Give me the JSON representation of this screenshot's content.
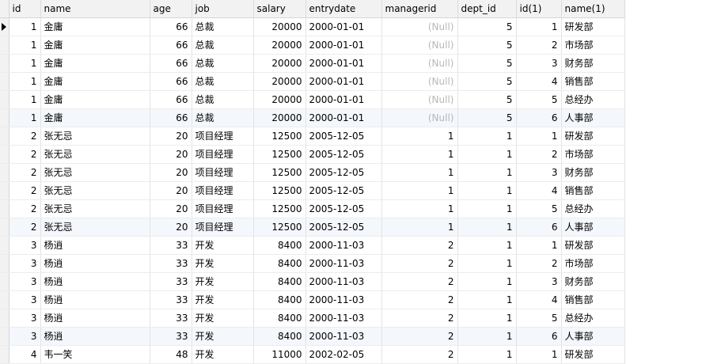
{
  "columns": [
    "id",
    "name",
    "age",
    "job",
    "salary",
    "entrydate",
    "managerid",
    "dept_id",
    "id(1)",
    "name(1)"
  ],
  "null_label": "(Null)",
  "rows": [
    {
      "id": "1",
      "name": "金庸",
      "age": "66",
      "job": "总裁",
      "salary": "20000",
      "entrydate": "2000-01-01",
      "managerid": "(Null)",
      "dept_id": "5",
      "id1": "1",
      "name1": "研发部"
    },
    {
      "id": "1",
      "name": "金庸",
      "age": "66",
      "job": "总裁",
      "salary": "20000",
      "entrydate": "2000-01-01",
      "managerid": "(Null)",
      "dept_id": "5",
      "id1": "2",
      "name1": "市场部"
    },
    {
      "id": "1",
      "name": "金庸",
      "age": "66",
      "job": "总裁",
      "salary": "20000",
      "entrydate": "2000-01-01",
      "managerid": "(Null)",
      "dept_id": "5",
      "id1": "3",
      "name1": "财务部"
    },
    {
      "id": "1",
      "name": "金庸",
      "age": "66",
      "job": "总裁",
      "salary": "20000",
      "entrydate": "2000-01-01",
      "managerid": "(Null)",
      "dept_id": "5",
      "id1": "4",
      "name1": "销售部"
    },
    {
      "id": "1",
      "name": "金庸",
      "age": "66",
      "job": "总裁",
      "salary": "20000",
      "entrydate": "2000-01-01",
      "managerid": "(Null)",
      "dept_id": "5",
      "id1": "5",
      "name1": "总经办"
    },
    {
      "id": "1",
      "name": "金庸",
      "age": "66",
      "job": "总裁",
      "salary": "20000",
      "entrydate": "2000-01-01",
      "managerid": "(Null)",
      "dept_id": "5",
      "id1": "6",
      "name1": "人事部"
    },
    {
      "id": "2",
      "name": "张无忌",
      "age": "20",
      "job": "项目经理",
      "salary": "12500",
      "entrydate": "2005-12-05",
      "managerid": "1",
      "dept_id": "1",
      "id1": "1",
      "name1": "研发部"
    },
    {
      "id": "2",
      "name": "张无忌",
      "age": "20",
      "job": "项目经理",
      "salary": "12500",
      "entrydate": "2005-12-05",
      "managerid": "1",
      "dept_id": "1",
      "id1": "2",
      "name1": "市场部"
    },
    {
      "id": "2",
      "name": "张无忌",
      "age": "20",
      "job": "项目经理",
      "salary": "12500",
      "entrydate": "2005-12-05",
      "managerid": "1",
      "dept_id": "1",
      "id1": "3",
      "name1": "财务部"
    },
    {
      "id": "2",
      "name": "张无忌",
      "age": "20",
      "job": "项目经理",
      "salary": "12500",
      "entrydate": "2005-12-05",
      "managerid": "1",
      "dept_id": "1",
      "id1": "4",
      "name1": "销售部"
    },
    {
      "id": "2",
      "name": "张无忌",
      "age": "20",
      "job": "项目经理",
      "salary": "12500",
      "entrydate": "2005-12-05",
      "managerid": "1",
      "dept_id": "1",
      "id1": "5",
      "name1": "总经办"
    },
    {
      "id": "2",
      "name": "张无忌",
      "age": "20",
      "job": "项目经理",
      "salary": "12500",
      "entrydate": "2005-12-05",
      "managerid": "1",
      "dept_id": "1",
      "id1": "6",
      "name1": "人事部"
    },
    {
      "id": "3",
      "name": "杨逍",
      "age": "33",
      "job": "开发",
      "salary": "8400",
      "entrydate": "2000-11-03",
      "managerid": "2",
      "dept_id": "1",
      "id1": "1",
      "name1": "研发部"
    },
    {
      "id": "3",
      "name": "杨逍",
      "age": "33",
      "job": "开发",
      "salary": "8400",
      "entrydate": "2000-11-03",
      "managerid": "2",
      "dept_id": "1",
      "id1": "2",
      "name1": "市场部"
    },
    {
      "id": "3",
      "name": "杨逍",
      "age": "33",
      "job": "开发",
      "salary": "8400",
      "entrydate": "2000-11-03",
      "managerid": "2",
      "dept_id": "1",
      "id1": "3",
      "name1": "财务部"
    },
    {
      "id": "3",
      "name": "杨逍",
      "age": "33",
      "job": "开发",
      "salary": "8400",
      "entrydate": "2000-11-03",
      "managerid": "2",
      "dept_id": "1",
      "id1": "4",
      "name1": "销售部"
    },
    {
      "id": "3",
      "name": "杨逍",
      "age": "33",
      "job": "开发",
      "salary": "8400",
      "entrydate": "2000-11-03",
      "managerid": "2",
      "dept_id": "1",
      "id1": "5",
      "name1": "总经办"
    },
    {
      "id": "3",
      "name": "杨逍",
      "age": "33",
      "job": "开发",
      "salary": "8400",
      "entrydate": "2000-11-03",
      "managerid": "2",
      "dept_id": "1",
      "id1": "6",
      "name1": "人事部"
    },
    {
      "id": "4",
      "name": "韦一笑",
      "age": "48",
      "job": "开发",
      "salary": "11000",
      "entrydate": "2002-02-05",
      "managerid": "2",
      "dept_id": "1",
      "id1": "1",
      "name1": "研发部"
    }
  ]
}
